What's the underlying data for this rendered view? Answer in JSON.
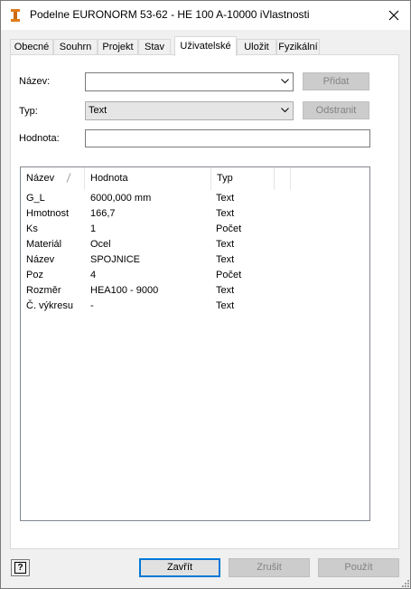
{
  "window": {
    "title": "Podelne EURONORM 53-62 - HE 100 A-10000 iVlastnosti",
    "icon": "i-beam-icon",
    "close_icon": "close-icon"
  },
  "tabs": [
    {
      "label": "Obecné",
      "active": false
    },
    {
      "label": "Souhrn",
      "active": false
    },
    {
      "label": "Projekt",
      "active": false
    },
    {
      "label": "Stav",
      "active": false
    },
    {
      "label": "Uživatelské",
      "active": true
    },
    {
      "label": "Uložit",
      "active": false
    },
    {
      "label": "Fyzikální",
      "active": false
    }
  ],
  "form": {
    "name_label": "Název:",
    "name_value": "",
    "add_button": "Přidat",
    "type_label": "Typ:",
    "type_value": "Text",
    "remove_button": "Odstranit",
    "value_label": "Hodnota:",
    "value_value": ""
  },
  "list": {
    "columns": [
      "Název",
      "Hodnota",
      "Typ"
    ],
    "sort_column": "Název",
    "rows": [
      {
        "name": "G_L",
        "value": "6000,000 mm",
        "type": "Text"
      },
      {
        "name": "Hmotnost",
        "value": "166,7",
        "type": "Text"
      },
      {
        "name": "Ks",
        "value": "1",
        "type": "Počet"
      },
      {
        "name": "Materiál",
        "value": "Ocel",
        "type": "Text"
      },
      {
        "name": "Název",
        "value": "SPOJNICE",
        "type": "Text"
      },
      {
        "name": "Poz",
        "value": "4",
        "type": "Počet"
      },
      {
        "name": "Rozměr",
        "value": "HEA100 - 9000",
        "type": "Text"
      },
      {
        "name": "Č. výkresu",
        "value": "-",
        "type": "Text"
      }
    ]
  },
  "footer": {
    "help_label": "?",
    "close_button": "Zavřít",
    "cancel_button": "Zrušit",
    "apply_button": "Použít"
  },
  "colors": {
    "accent": "#0078d7",
    "disabled_bg": "#cccccc",
    "disabled_text": "#838383"
  }
}
